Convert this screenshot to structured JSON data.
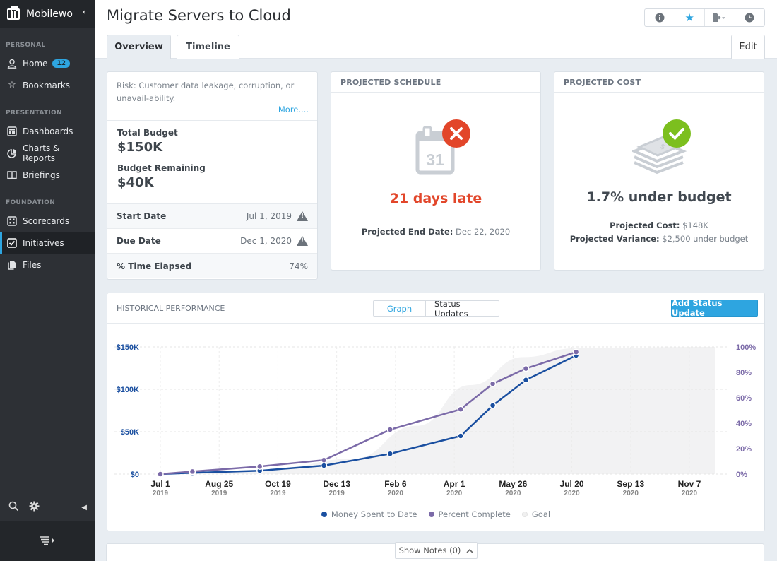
{
  "sidebar": {
    "app_name": "Mobilewo",
    "sections": [
      {
        "label": "PERSONAL",
        "items": [
          {
            "label": "Home",
            "icon": "user-icon",
            "badge": "12"
          },
          {
            "label": "Bookmarks",
            "icon": "star-icon"
          }
        ]
      },
      {
        "label": "PRESENTATION",
        "items": [
          {
            "label": "Dashboards",
            "icon": "dashboard-icon"
          },
          {
            "label": "Charts & Reports",
            "icon": "pie-chart-icon"
          },
          {
            "label": "Briefings",
            "icon": "book-icon"
          }
        ]
      },
      {
        "label": "FOUNDATION",
        "items": [
          {
            "label": "Scorecards",
            "icon": "grid-icon"
          },
          {
            "label": "Initiatives",
            "icon": "checkbox-icon",
            "active": true
          },
          {
            "label": "Files",
            "icon": "files-icon"
          }
        ]
      }
    ]
  },
  "header": {
    "title": "Migrate Servers to Cloud",
    "tabs": [
      {
        "label": "Overview",
        "active": true
      },
      {
        "label": "Timeline",
        "active": false
      }
    ],
    "edit_label": "Edit",
    "icons": [
      "info-icon",
      "star-icon",
      "export-icon",
      "history-icon"
    ]
  },
  "summary": {
    "risk_text": "Risk: Customer data leakage, corruption, or unavail-ability.",
    "more_label": "More....",
    "total_budget_label": "Total Budget",
    "total_budget_value": "$150K",
    "budget_remaining_label": "Budget Remaining",
    "budget_remaining_value": "$40K",
    "rows": [
      {
        "label": "Start Date",
        "value": "Jul 1, 2019",
        "warning": true
      },
      {
        "label": "Due Date",
        "value": "Dec 1, 2020",
        "warning": true
      },
      {
        "label": "% Time Elapsed",
        "value": "74%",
        "warning": false
      }
    ]
  },
  "schedule": {
    "heading": "PROJECTED SCHEDULE",
    "calendar_day": "31",
    "status": "21 days late",
    "status_color": "#e2462a",
    "end_date_label": "Projected End Date:",
    "end_date_value": "Dec 22, 2020"
  },
  "cost": {
    "heading": "PROJECTED COST",
    "status": "1.7% under budget",
    "status_color": "#414850",
    "cost_label": "Projected Cost:",
    "cost_value": "$148K",
    "variance_label": "Projected Variance:",
    "variance_value": "$2,500 under budget"
  },
  "performance": {
    "heading": "HISTORICAL PERFORMANCE",
    "toggle": [
      {
        "label": "Graph",
        "active": true
      },
      {
        "label": "Status Updates",
        "active": false
      }
    ],
    "add_label": "Add Status Update",
    "legend": [
      {
        "label": "Money Spent to Date",
        "color": "#1a4fa0"
      },
      {
        "label": "Percent Complete",
        "color": "#7b6aa8"
      },
      {
        "label": "Goal",
        "color": "#ececec"
      }
    ]
  },
  "notes": {
    "label": "Show Notes (0)"
  },
  "chart_data": {
    "type": "line",
    "title": "Historical Performance",
    "x_unit": "days since Jul 1, 2019",
    "xlim": [
      0,
      510
    ],
    "x_ticks": [
      {
        "day": 0,
        "label": "Jul 1",
        "year": "2019"
      },
      {
        "day": 55,
        "label": "Aug 25",
        "year": "2019"
      },
      {
        "day": 110,
        "label": "Oct 19",
        "year": "2019"
      },
      {
        "day": 165,
        "label": "Dec 13",
        "year": "2019"
      },
      {
        "day": 220,
        "label": "Feb 6",
        "year": "2020"
      },
      {
        "day": 275,
        "label": "Apr 1",
        "year": "2020"
      },
      {
        "day": 330,
        "label": "May 26",
        "year": "2020"
      },
      {
        "day": 385,
        "label": "Jul 20",
        "year": "2020"
      },
      {
        "day": 440,
        "label": "Sep 13",
        "year": "2020"
      },
      {
        "day": 495,
        "label": "Nov 7",
        "year": "2020"
      }
    ],
    "y_left": {
      "label": "Money Spent",
      "lim": [
        0,
        150
      ],
      "unit": "$K",
      "ticks": [
        "$0",
        "$50K",
        "$100K",
        "$150K"
      ],
      "tick_values": [
        0,
        50,
        100,
        150
      ]
    },
    "y_right": {
      "label": "Percent Complete",
      "lim": [
        0,
        100
      ],
      "ticks": [
        "0%",
        "20%",
        "40%",
        "60%",
        "80%",
        "100%"
      ],
      "tick_values": [
        0,
        20,
        40,
        60,
        80,
        100
      ]
    },
    "series": [
      {
        "name": "Money Spent to Date",
        "axis": "left",
        "color": "#1a4fa0",
        "x": [
          0,
          30,
          93,
          153,
          215,
          281,
          311,
          342,
          389
        ],
        "values": [
          0,
          1.5,
          4,
          10,
          24,
          45,
          81,
          111,
          140
        ]
      },
      {
        "name": "Percent Complete",
        "axis": "right",
        "color": "#7b6aa8",
        "x": [
          0,
          30,
          93,
          153,
          215,
          281,
          311,
          342,
          389
        ],
        "values": [
          0,
          2,
          6,
          11,
          35,
          51,
          71,
          83,
          96
        ]
      },
      {
        "name": "Goal",
        "axis": "right",
        "color": "#efefef",
        "type": "area",
        "x": [
          0,
          100,
          180,
          240,
          290,
          340,
          389,
          520
        ],
        "values": [
          0,
          3,
          12,
          38,
          70,
          92,
          99,
          100
        ]
      }
    ],
    "grid": true,
    "legend_position": "bottom"
  }
}
